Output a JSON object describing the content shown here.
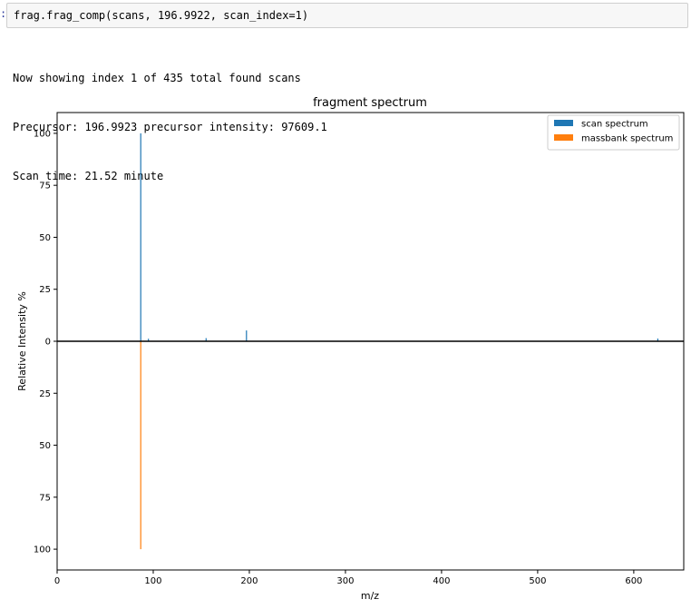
{
  "cell": {
    "prompt": ":",
    "code": "frag.frag_comp(scans, 196.9922, scan_index=1)"
  },
  "output": {
    "lines": [
      "Now showing index 1 of 435 total found scans",
      "Precursor: 196.9923 precursor intensity: 97609.1",
      "Scan time: 21.52 minute"
    ]
  },
  "chart_data": {
    "type": "bar",
    "title": "fragment spectrum",
    "xlabel": "m/z",
    "ylabel": "Relative Intensity %",
    "xlim": [
      0,
      652
    ],
    "ylim": [
      -110,
      110
    ],
    "xticks": [
      0,
      100,
      200,
      300,
      400,
      500,
      600
    ],
    "yticks": [
      100,
      75,
      50,
      25,
      0,
      -25,
      -50,
      -75,
      -100
    ],
    "ytick_labels": [
      "100",
      "75",
      "50",
      "25",
      "0",
      "25",
      "50",
      "75",
      "100"
    ],
    "grid": false,
    "legend_position": "top-right",
    "series": [
      {
        "name": "scan spectrum",
        "color": "#1f77b4",
        "x": [
          87.0,
          95.0,
          155.0,
          197.0,
          625.0
        ],
        "values": [
          100,
          1.2,
          1.5,
          5.2,
          1.3
        ]
      },
      {
        "name": "massbank spectrum",
        "color": "#ff7f0e",
        "x": [
          87.0
        ],
        "values": [
          -100
        ]
      }
    ]
  }
}
